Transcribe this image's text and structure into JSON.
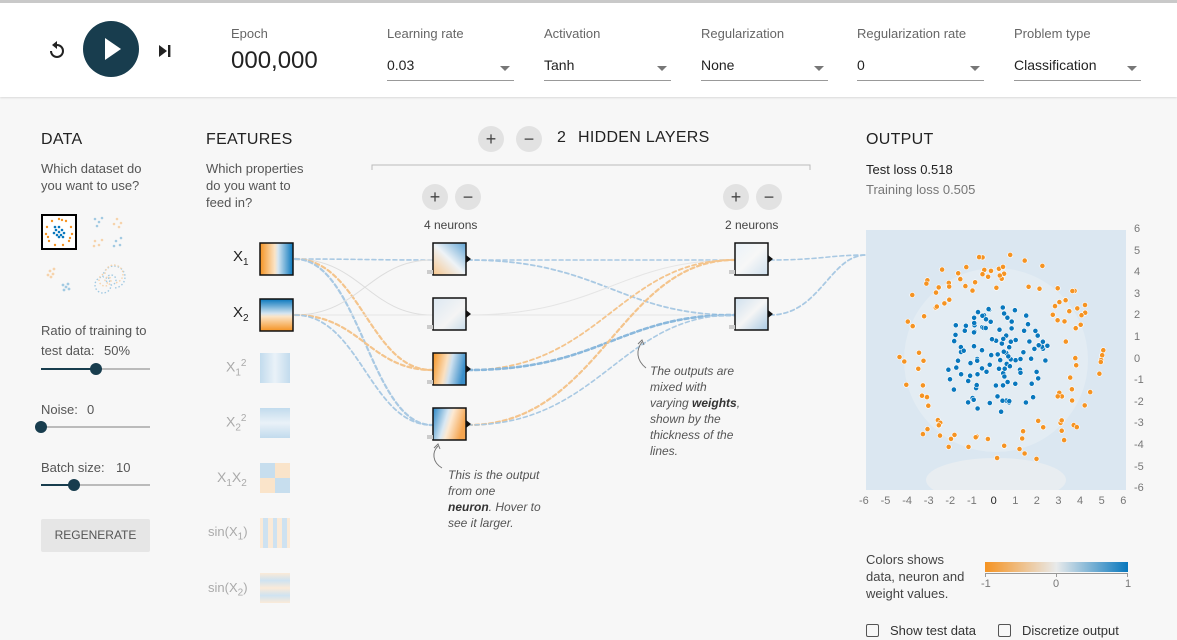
{
  "header": {
    "epoch_label": "Epoch",
    "epoch_value": "000,000",
    "controls": [
      {
        "label": "Learning rate",
        "value": "0.03"
      },
      {
        "label": "Activation",
        "value": "Tanh"
      },
      {
        "label": "Regularization",
        "value": "None"
      },
      {
        "label": "Regularization rate",
        "value": "0"
      },
      {
        "label": "Problem type",
        "value": "Classification"
      }
    ]
  },
  "data_panel": {
    "title": "DATA",
    "subtitle_1": "Which dataset do",
    "subtitle_2": "you want to use?",
    "ratio_label_1": "Ratio of training to",
    "ratio_label_2": "test data:",
    "ratio_value": "50%",
    "ratio_fraction": 0.5,
    "noise_label": "Noise:",
    "noise_value": "0",
    "noise_fraction": 0,
    "batch_label": "Batch size:",
    "batch_value": "10",
    "batch_fraction": 0.3,
    "regenerate_label": "REGENERATE"
  },
  "features_panel": {
    "title": "FEATURES",
    "subtitle_1": "Which properties",
    "subtitle_2": "do you want to",
    "subtitle_3": "feed in?",
    "features": [
      {
        "base": "X",
        "sub": "1",
        "sup": "",
        "suffix": "",
        "active": true
      },
      {
        "base": "X",
        "sub": "2",
        "sup": "",
        "suffix": "",
        "active": true
      },
      {
        "base": "X",
        "sub": "1",
        "sup": "2",
        "suffix": "",
        "active": false
      },
      {
        "base": "X",
        "sub": "2",
        "sup": "2",
        "suffix": "",
        "active": false
      },
      {
        "base": "X",
        "sub": "1",
        "sup": "",
        "suffix": "X2",
        "active": false
      },
      {
        "base": "sin(X",
        "sub": "1",
        "sup": "",
        "suffix": ")",
        "active": false
      },
      {
        "base": "sin(X",
        "sub": "2",
        "sup": "",
        "suffix": ")",
        "active": false
      }
    ]
  },
  "network": {
    "hidden_layers_count": "2",
    "hidden_layers_label": "HIDDEN LAYERS",
    "add_symbol": "+",
    "remove_symbol": "−",
    "layer1_neurons": "4 neurons",
    "layer2_neurons": "2 neurons",
    "note_neuron_1": "This is the output",
    "note_neuron_2": "from one",
    "note_neuron_3_bold": "neuron",
    "note_neuron_3_rest": ". Hover to",
    "note_neuron_4": "see it larger.",
    "note_weights_1": "The outputs are",
    "note_weights_2": "mixed with",
    "note_weights_3_pre": "varying ",
    "note_weights_3_bold": "weights",
    "note_weights_3_post": ",",
    "note_weights_4": "shown by the",
    "note_weights_5": "thickness of the",
    "note_weights_6": "lines."
  },
  "output_panel": {
    "title": "OUTPUT",
    "test_loss_label": "Test loss",
    "test_loss_value": "0.518",
    "training_loss_label": "Training loss",
    "training_loss_value": "0.505",
    "x_ticks": [
      "-6",
      "-5",
      "-4",
      "-3",
      "-2",
      "-1",
      "0",
      "1",
      "2",
      "3",
      "4",
      "5",
      "6"
    ],
    "y_ticks": [
      "6",
      "5",
      "4",
      "3",
      "2",
      "1",
      "0",
      "-1",
      "-2",
      "-3",
      "-4",
      "-5",
      "-6"
    ],
    "legend_text_1": "Colors shows",
    "legend_text_2": "data, neuron and",
    "legend_text_3": "weight values.",
    "legend_min": "-1",
    "legend_mid": "0",
    "legend_max": "1",
    "show_test_data_label": "Show test data",
    "discretize_label": "Discretize output"
  },
  "colors": {
    "orange": "#f59322",
    "blue": "#0877bd",
    "dark": "#183d4e"
  }
}
